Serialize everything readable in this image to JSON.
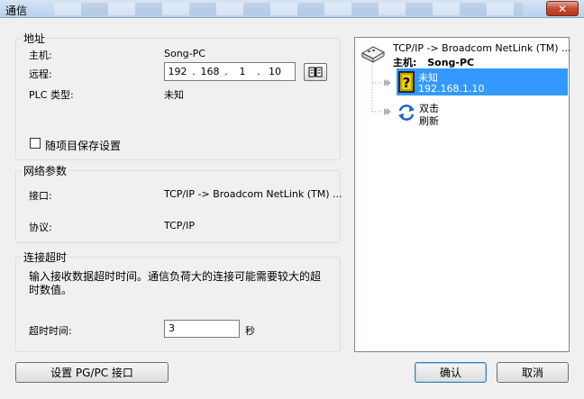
{
  "window": {
    "title": "通信",
    "close_label": "✕"
  },
  "address": {
    "legend": "地址",
    "host_label": "主机:",
    "host_value": "Song-PC",
    "remote_label": "远程:",
    "ip": [
      "192",
      "168",
      "1",
      "10"
    ],
    "plc_type_label": "PLC 类型:",
    "plc_type_value": "未知",
    "save_checkbox_label": "随项目保存设置",
    "save_checked": false
  },
  "network": {
    "legend": "网络参数",
    "interface_label": "接口:",
    "interface_value": "TCP/IP -> Broadcom NetLink (TM) ...",
    "protocol_label": "协议:",
    "protocol_value": "TCP/IP"
  },
  "timeout": {
    "legend": "连接超时",
    "description_line1": "输入接收数据超时时间。通信负荷大的连接可能需要较大的超",
    "description_line2": "时数值。",
    "time_label": "超时时间:",
    "time_value": "3",
    "unit": "秒"
  },
  "buttons": {
    "setup_pgpc": "设置 PG/PC 接口",
    "ok": "确认",
    "cancel": "取消"
  },
  "tree": {
    "root_label": "TCP/IP -> Broadcom NetLink (TM) ...",
    "host_prefix": "主机:",
    "host_name": "Song-PC",
    "device_name": "未知",
    "device_ip": "192.168.1.10",
    "refresh_line1": "双击",
    "refresh_line2": "刷新"
  }
}
